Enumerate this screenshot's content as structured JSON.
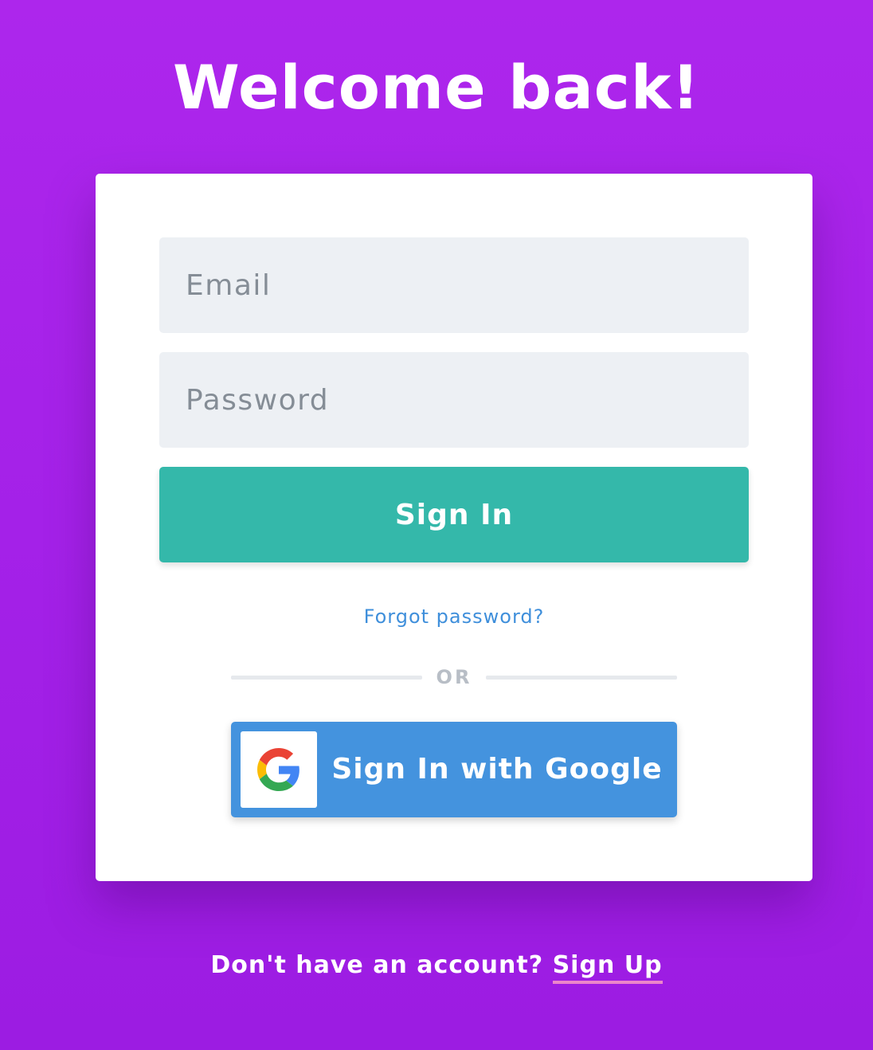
{
  "page": {
    "title": "Welcome back!"
  },
  "form": {
    "email_placeholder": "Email",
    "email_value": "",
    "password_placeholder": "Password",
    "password_value": "",
    "signin_label": "Sign In",
    "forgot_label": "Forgot password?",
    "divider_label": "OR",
    "google_label": "Sign In with Google",
    "google_icon": "google-g-icon"
  },
  "footer": {
    "prompt": "Don't have an account?",
    "signup_label": "Sign Up"
  },
  "colors": {
    "background": "#a421e8",
    "primary_button": "#34b8aa",
    "google_button": "#4493de",
    "link": "#3f8fdb",
    "signup_underline": "#ec86c9"
  }
}
